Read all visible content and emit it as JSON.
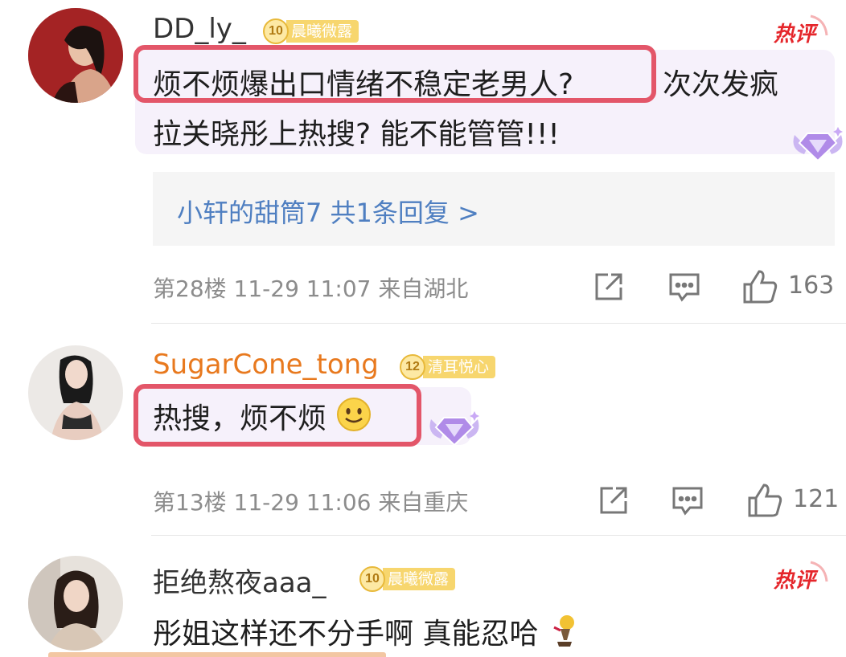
{
  "comments": [
    {
      "username": "DD_ly_",
      "badge_level": "10",
      "badge_title": "晨曦微露",
      "hot_label": "热评",
      "text_line1_highlight": "烦不烦爆出口情绪不稳定老男人?",
      "text_line1_rest": "次次发疯",
      "text_line2": "拉关晓彤上热搜? 能不能管管!!!",
      "reply_summary": "小轩的甜筒7 共1条回复 >",
      "floor_meta": "第28楼 11-29 11:07 来自湖北",
      "likes": "163"
    },
    {
      "username": "SugarCone_tong",
      "badge_level": "12",
      "badge_title": "清耳悦心",
      "text_line1_highlight": "热搜，烦不烦",
      "floor_meta": "第13楼 11-29 11:06 来自重庆",
      "likes": "121"
    },
    {
      "username": "拒绝熬夜aaa_",
      "badge_level": "10",
      "badge_title": "晨曦微露",
      "hot_label": "热评",
      "text_line1": "彤姐这样还不分手啊 真能忍哈"
    }
  ],
  "icons": {
    "share": "share-icon",
    "comment": "comment-icon",
    "like": "thumbs-up-icon",
    "emoji_smile": "smile-emoji-icon",
    "diamond": "diamond-badge-icon"
  },
  "colors": {
    "highlight_border": "#e35669",
    "reply_link": "#4f7fc1",
    "badge_gold": "#f7d66e",
    "hot_red": "#e5262b",
    "username_orange": "#e8791e"
  }
}
